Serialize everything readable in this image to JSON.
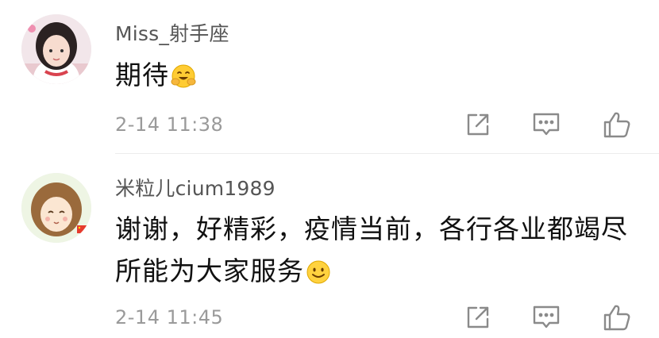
{
  "comments": [
    {
      "username": "Miss_射手座",
      "text": "期待",
      "emoji": "smiling-face-with-hands-emoji",
      "time": "2-14 11:38",
      "icons": [
        "share-icon",
        "comment-icon",
        "thumbs-up-icon"
      ]
    },
    {
      "username": "米粒儿cium1989",
      "text": "谢谢，好精彩，疫情当前，各行各业都竭尽所能为大家服务",
      "emoji": "smiling-face-emoji",
      "time": "2-14 11:45",
      "icons": [
        "share-icon",
        "comment-icon",
        "thumbs-up-icon"
      ]
    }
  ],
  "colors": {
    "username": "#555555",
    "text": "#111111",
    "time": "#9a9a9a",
    "icon": "#8a8a8a",
    "divider": "#ececec"
  }
}
